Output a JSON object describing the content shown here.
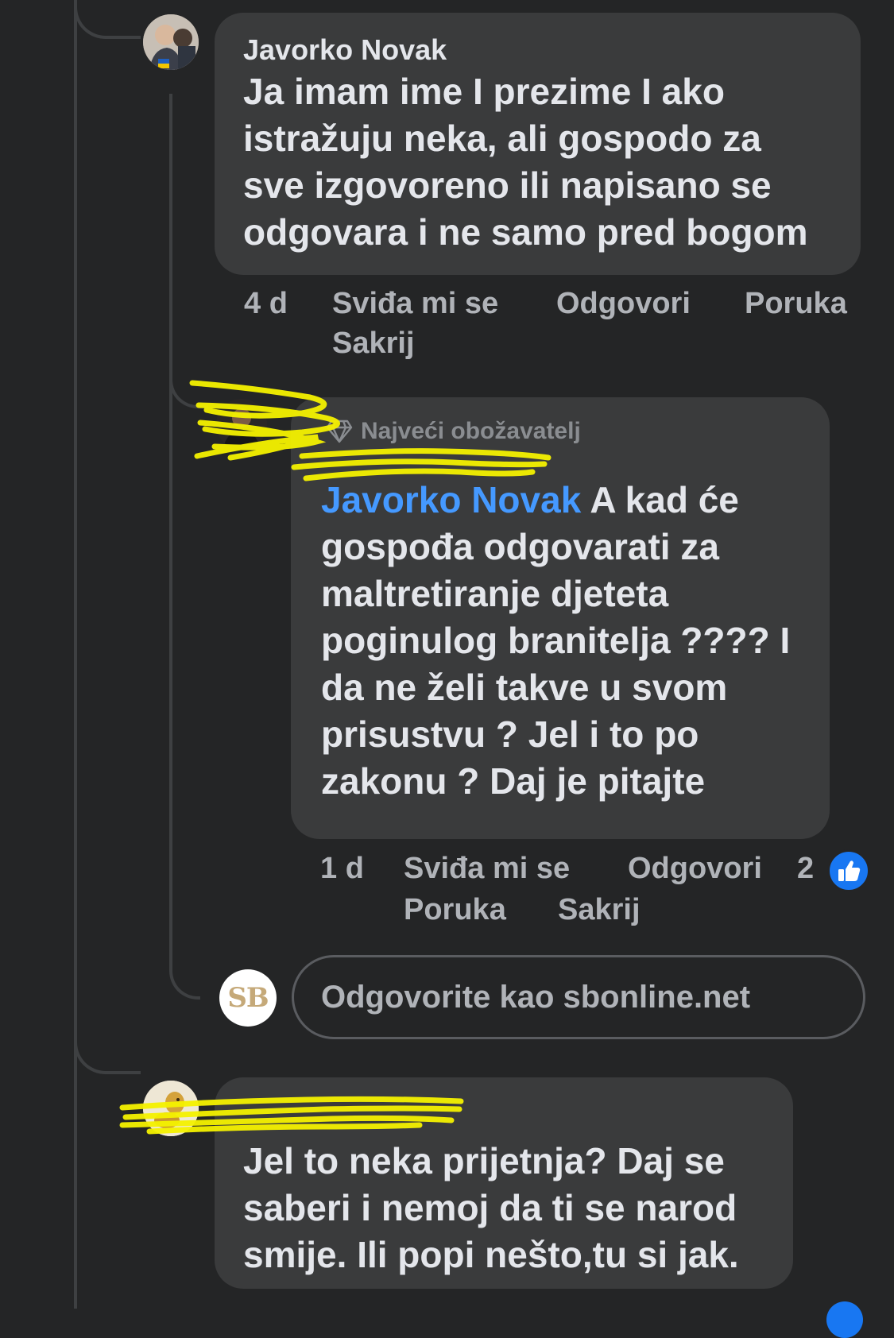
{
  "comment1": {
    "author": "Javorko Novak",
    "text_lines": [
      "Ja imam ime I prezime I ako",
      "istražuju neka, ali gospodo za",
      "sve izgovoreno ili napisano se",
      "odgovara i ne samo pred bogom"
    ],
    "time": "4 d",
    "like_label": "Sviđa mi se",
    "reply_label": "Odgovori",
    "message_label": "Poruka",
    "hide_label": "Sakrij"
  },
  "comment2": {
    "badge_label": "Najveći obožavatelj",
    "mention": "Javorko Novak",
    "text_first": " A kad će",
    "text_lines": [
      "gospođa odgovarati za",
      "maltretiranje djeteta",
      "poginulog branitelja ???? I",
      "da ne želi takve u svom",
      "prisustvu ? Jel i to po",
      "zakonu ? Daj je pitajte"
    ],
    "time": "1 d",
    "like_label": "Sviđa mi se",
    "reply_label": "Odgovori",
    "reaction_count": "2",
    "message_label": "Poruka",
    "hide_label": "Sakrij"
  },
  "reply_box": {
    "avatar_initials": "SB",
    "placeholder": "Odgovorite kao sbonline.net"
  },
  "comment3": {
    "text_lines": [
      "Jel to neka prijetnja? Daj se",
      "saberi i nemoj da ti se narod",
      "smije. Ili popi nešto,tu si jak."
    ]
  },
  "colors": {
    "background": "#242526",
    "bubble": "#3a3b3c",
    "text": "#e4e6eb",
    "secondary_text": "#b0b3b8",
    "link": "#4599ff",
    "like_blue": "#1877f2",
    "redaction": "#f5f200"
  },
  "icons": {
    "badge": "diamond-icon",
    "reaction": "thumbs-up-icon"
  }
}
